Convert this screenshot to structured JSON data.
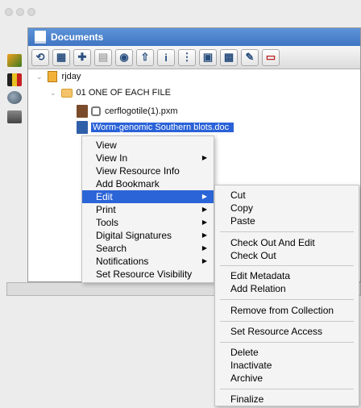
{
  "panel": {
    "title": "Documents"
  },
  "tree": {
    "root": "rjday",
    "folder": "01 ONE OF EACH FILE",
    "files": [
      "cerflogotile(1).pxm",
      "Worm-genomic Southern blots.doc"
    ]
  },
  "toolbar_icons": [
    "refresh-icon",
    "tree-icon",
    "add-icon",
    "disabled-icon",
    "view-icon",
    "upload-icon",
    "info-icon",
    "metadata-icon",
    "checkout-icon",
    "clipboard-icon",
    "pen-icon",
    "pdf-icon"
  ],
  "context_menu": {
    "items": [
      {
        "label": "View"
      },
      {
        "label": "View In",
        "submenu": true
      },
      {
        "label": "View Resource Info"
      },
      {
        "label": "Add Bookmark"
      },
      {
        "label": "Edit",
        "submenu": true,
        "highlighted": true
      },
      {
        "label": "Print",
        "submenu": true
      },
      {
        "label": "Tools",
        "submenu": true
      },
      {
        "label": "Digital Signatures",
        "submenu": true
      },
      {
        "label": "Search",
        "submenu": true
      },
      {
        "label": "Notifications",
        "submenu": true
      },
      {
        "label": "Set Resource Visibility"
      }
    ]
  },
  "edit_submenu": {
    "items": [
      "Cut",
      "Copy",
      "Paste",
      "Check Out And Edit",
      "Check Out",
      "Edit Metadata",
      "Add Relation",
      "Remove from Collection",
      "Set Resource Access",
      "Delete",
      "Inactivate",
      "Archive",
      "Finalize"
    ]
  },
  "colors": {
    "selection": "#2b64d6",
    "panel_header": "#4a80cc"
  }
}
